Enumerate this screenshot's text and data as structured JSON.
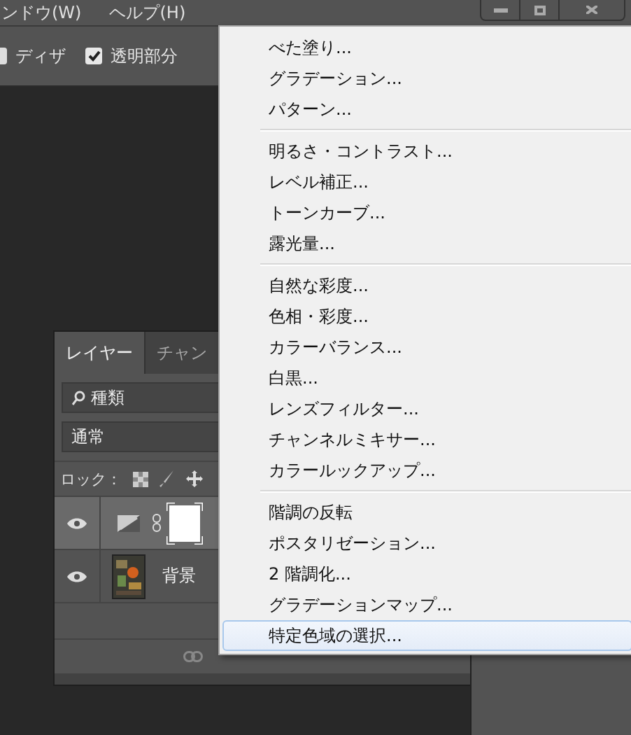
{
  "menubar": [
    "ンドウ(W)",
    "ヘルプ(H)"
  ],
  "options": [
    {
      "label": "ディザ",
      "checked": false
    },
    {
      "label": "透明部分",
      "checked": true
    }
  ],
  "layers_panel": {
    "tabs": [
      {
        "label": "レイヤー",
        "selected": true
      },
      {
        "label": "チャン",
        "selected": false
      }
    ],
    "filter": {
      "value": "種類"
    },
    "blend_mode": "通常",
    "lock_label": "ロック：",
    "layers": [
      {
        "kind": "adjustment",
        "visible": true,
        "selected": true
      },
      {
        "name": "背景",
        "visible": true,
        "selected": false
      }
    ]
  },
  "menu": {
    "groups": [
      [
        {
          "label": "べた塗り...",
          "selected": false
        },
        {
          "label": "グラデーション...",
          "selected": false
        },
        {
          "label": "パターン...",
          "selected": false
        }
      ],
      [
        {
          "label": "明るさ・コントラスト...",
          "selected": false
        },
        {
          "label": "レベル補正...",
          "selected": false
        },
        {
          "label": "トーンカーブ...",
          "selected": false
        },
        {
          "label": "露光量...",
          "selected": false
        }
      ],
      [
        {
          "label": "自然な彩度...",
          "selected": false
        },
        {
          "label": "色相・彩度...",
          "selected": false
        },
        {
          "label": "カラーバランス...",
          "selected": false
        },
        {
          "label": "白黒...",
          "selected": false
        },
        {
          "label": "レンズフィルター...",
          "selected": false
        },
        {
          "label": "チャンネルミキサー...",
          "selected": false
        },
        {
          "label": "カラールックアップ...",
          "selected": false
        }
      ],
      [
        {
          "label": "階調の反転",
          "selected": false
        },
        {
          "label": "ポスタリゼーション...",
          "selected": false
        },
        {
          "label": "2 階調化...",
          "selected": false
        },
        {
          "label": "グラデーションマップ...",
          "selected": false
        },
        {
          "label": "特定色域の選択...",
          "selected": true
        }
      ]
    ]
  }
}
